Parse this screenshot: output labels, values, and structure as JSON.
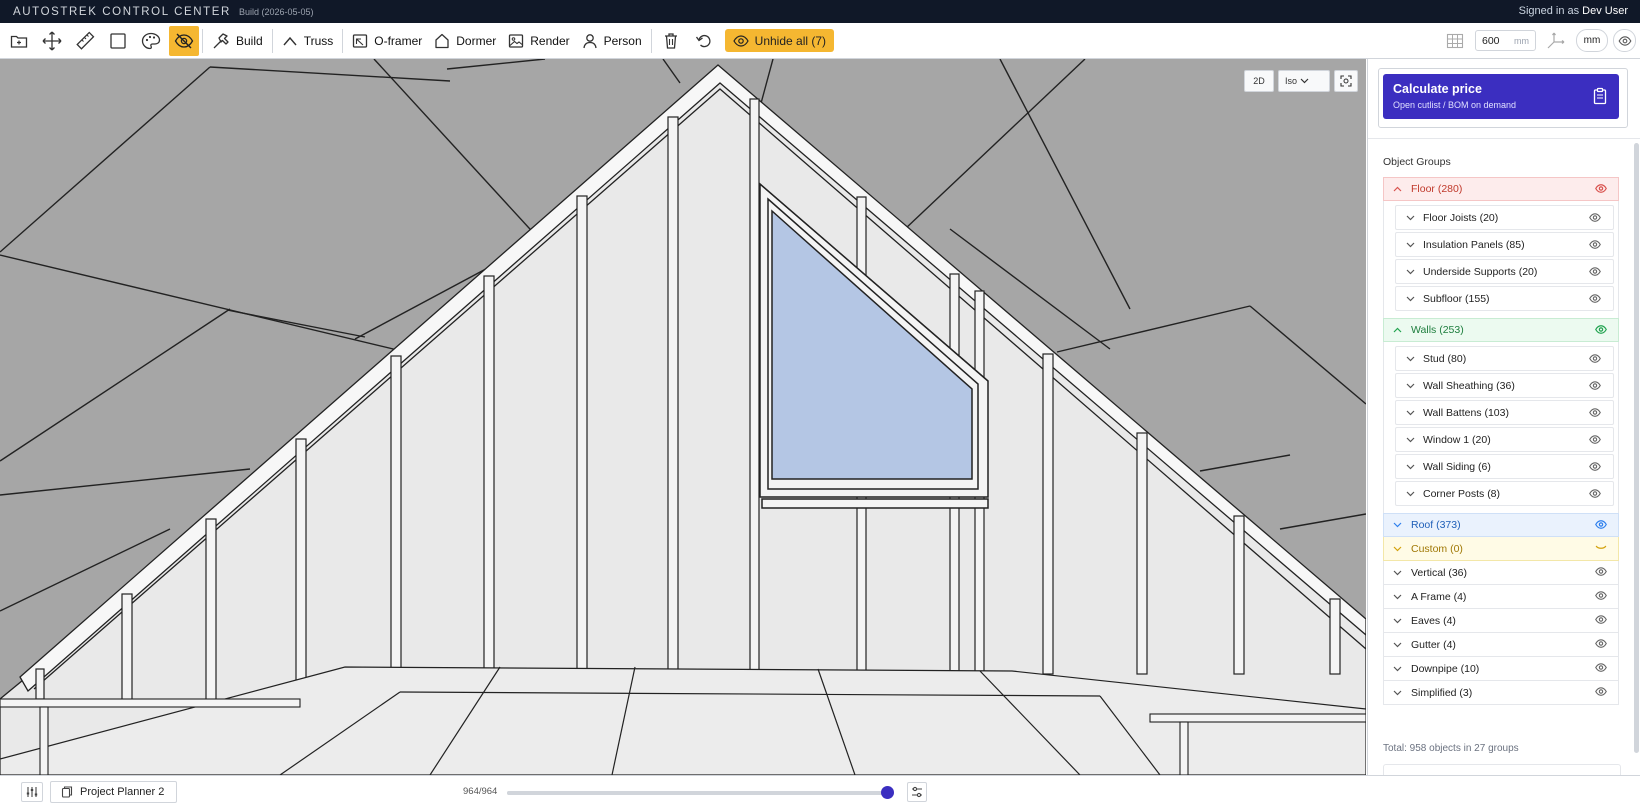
{
  "app": {
    "title": "AUTOSTREK CONTROL CENTER",
    "build": "Build (2026-05-05)",
    "signed_in_prefix": "Signed in as",
    "user": "Dev User"
  },
  "toolbar": {
    "build_label": "Build",
    "truss_label": "Truss",
    "oframer_label": "O-framer",
    "dormer_label": "Dormer",
    "render_label": "Render",
    "person_label": "Person",
    "unhide_label": "Unhide all (7)",
    "size_value": "600",
    "size_unit": "mm",
    "unit_toggle": "mm",
    "accent_color": "#f5b731"
  },
  "viewport": {
    "view_2d": "2D",
    "view_mode": "Iso",
    "window_glass_color": "#b4c6e4",
    "background_color": "#a6a6a6"
  },
  "sidebar": {
    "calc_title": "Calculate price",
    "calc_subtitle": "Open cutlist / BOM on demand",
    "calc_color": "#3b2ec0",
    "groups_title": "Object Groups",
    "floor": {
      "label": "Floor (280)",
      "color": "#d9534f"
    },
    "floor_items": [
      "Floor Joists (20)",
      "Insulation Panels (85)",
      "Underside Supports (20)",
      "Subfloor (155)"
    ],
    "walls": {
      "label": "Walls (253)",
      "color": "#22a350"
    },
    "walls_items": [
      "Stud (80)",
      "Wall Sheathing (36)",
      "Wall Battens (103)",
      "Window 1 (20)",
      "Wall Siding (6)",
      "Corner Posts (8)"
    ],
    "roof": {
      "label": "Roof (373)",
      "color": "#2f80ed"
    },
    "custom": {
      "label": "Custom (0)",
      "color": "#d4a20c"
    },
    "other_groups": [
      "Vertical (36)",
      "A Frame (4)",
      "Eaves (4)",
      "Gutter (4)",
      "Downpipe (10)",
      "Simplified (3)"
    ],
    "total": "Total: 958 objects in 27 groups"
  },
  "bottombar": {
    "project_tab": "Project Planner 2",
    "counter": "964/964",
    "slider_fraction": 1.0
  }
}
